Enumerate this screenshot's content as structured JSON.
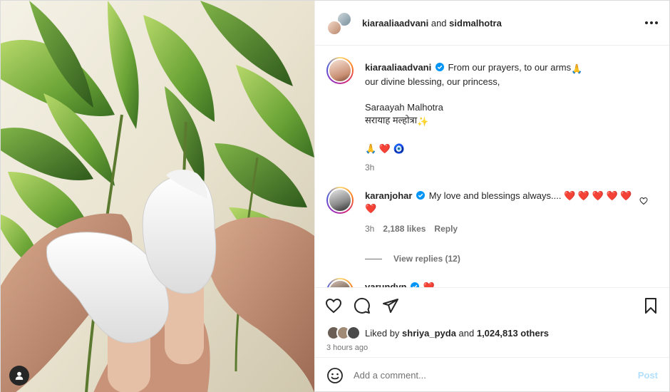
{
  "header": {
    "user1": "kiaraaliaadvani",
    "joiner": " and ",
    "user2": "sidmalhotra"
  },
  "caption": {
    "username": "kiaraaliaadvani",
    "line1": "From our prayers, to our arms",
    "line2": "our divine blessing, our princess,",
    "name_en": "Saraayah Malhotra",
    "name_hi": "सरायाह मल्होत्रा",
    "emoji_line": "🙏 ❤️ 🧿",
    "time": "3h"
  },
  "comments": [
    {
      "username": "karanjohar",
      "text": "My love and blessings always....",
      "hearts": "❤️ ❤️ ❤️ ❤️ ❤️ ❤️",
      "time": "3h",
      "likes": "2,188 likes",
      "reply": "Reply",
      "view_replies": "View replies (12)"
    },
    {
      "username": "varundvn",
      "text": "❤️"
    }
  ],
  "likes": {
    "prefix": "Liked by ",
    "user": "shriya_pyda",
    "middle": " and ",
    "count": "1,024,813 others"
  },
  "post_time": "3 hours ago",
  "add_comment": {
    "placeholder": "Add a comment...",
    "post_label": "Post"
  },
  "colors": {
    "verified": "#0095f6",
    "heart": "#ff3040",
    "post_disabled": "#b2dffc"
  }
}
